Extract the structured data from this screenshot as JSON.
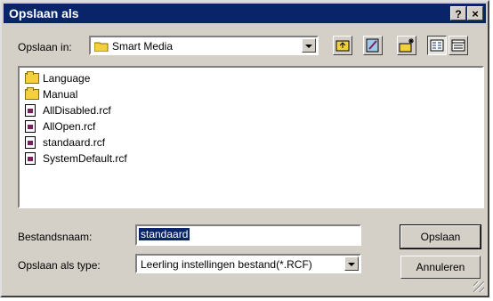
{
  "dialog": {
    "title": "Opslaan als",
    "help_label": "?",
    "close_label": "×"
  },
  "location": {
    "label": "Opslaan in:",
    "value": "Smart Media"
  },
  "toolbar": {
    "icons": [
      "up-one-level-icon",
      "favorites-icon",
      "new-folder-icon",
      "list-view-icon",
      "details-view-icon"
    ]
  },
  "files": [
    {
      "name": "Language",
      "type": "folder"
    },
    {
      "name": "Manual",
      "type": "folder"
    },
    {
      "name": "AllDisabled.rcf",
      "type": "file"
    },
    {
      "name": "AllOpen.rcf",
      "type": "file"
    },
    {
      "name": "standaard.rcf",
      "type": "file"
    },
    {
      "name": "SystemDefault.rcf",
      "type": "file"
    }
  ],
  "filename": {
    "label": "Bestandsnaam:",
    "value": "standaard"
  },
  "filetype": {
    "label": "Opslaan als type:",
    "value": "Leerling instellingen bestand(*.RCF)"
  },
  "buttons": {
    "save": "Opslaan",
    "cancel": "Annuleren"
  },
  "colors": {
    "titlebar": "#0a246a",
    "face": "#d4d0c8",
    "folder": "#f4d03f"
  }
}
